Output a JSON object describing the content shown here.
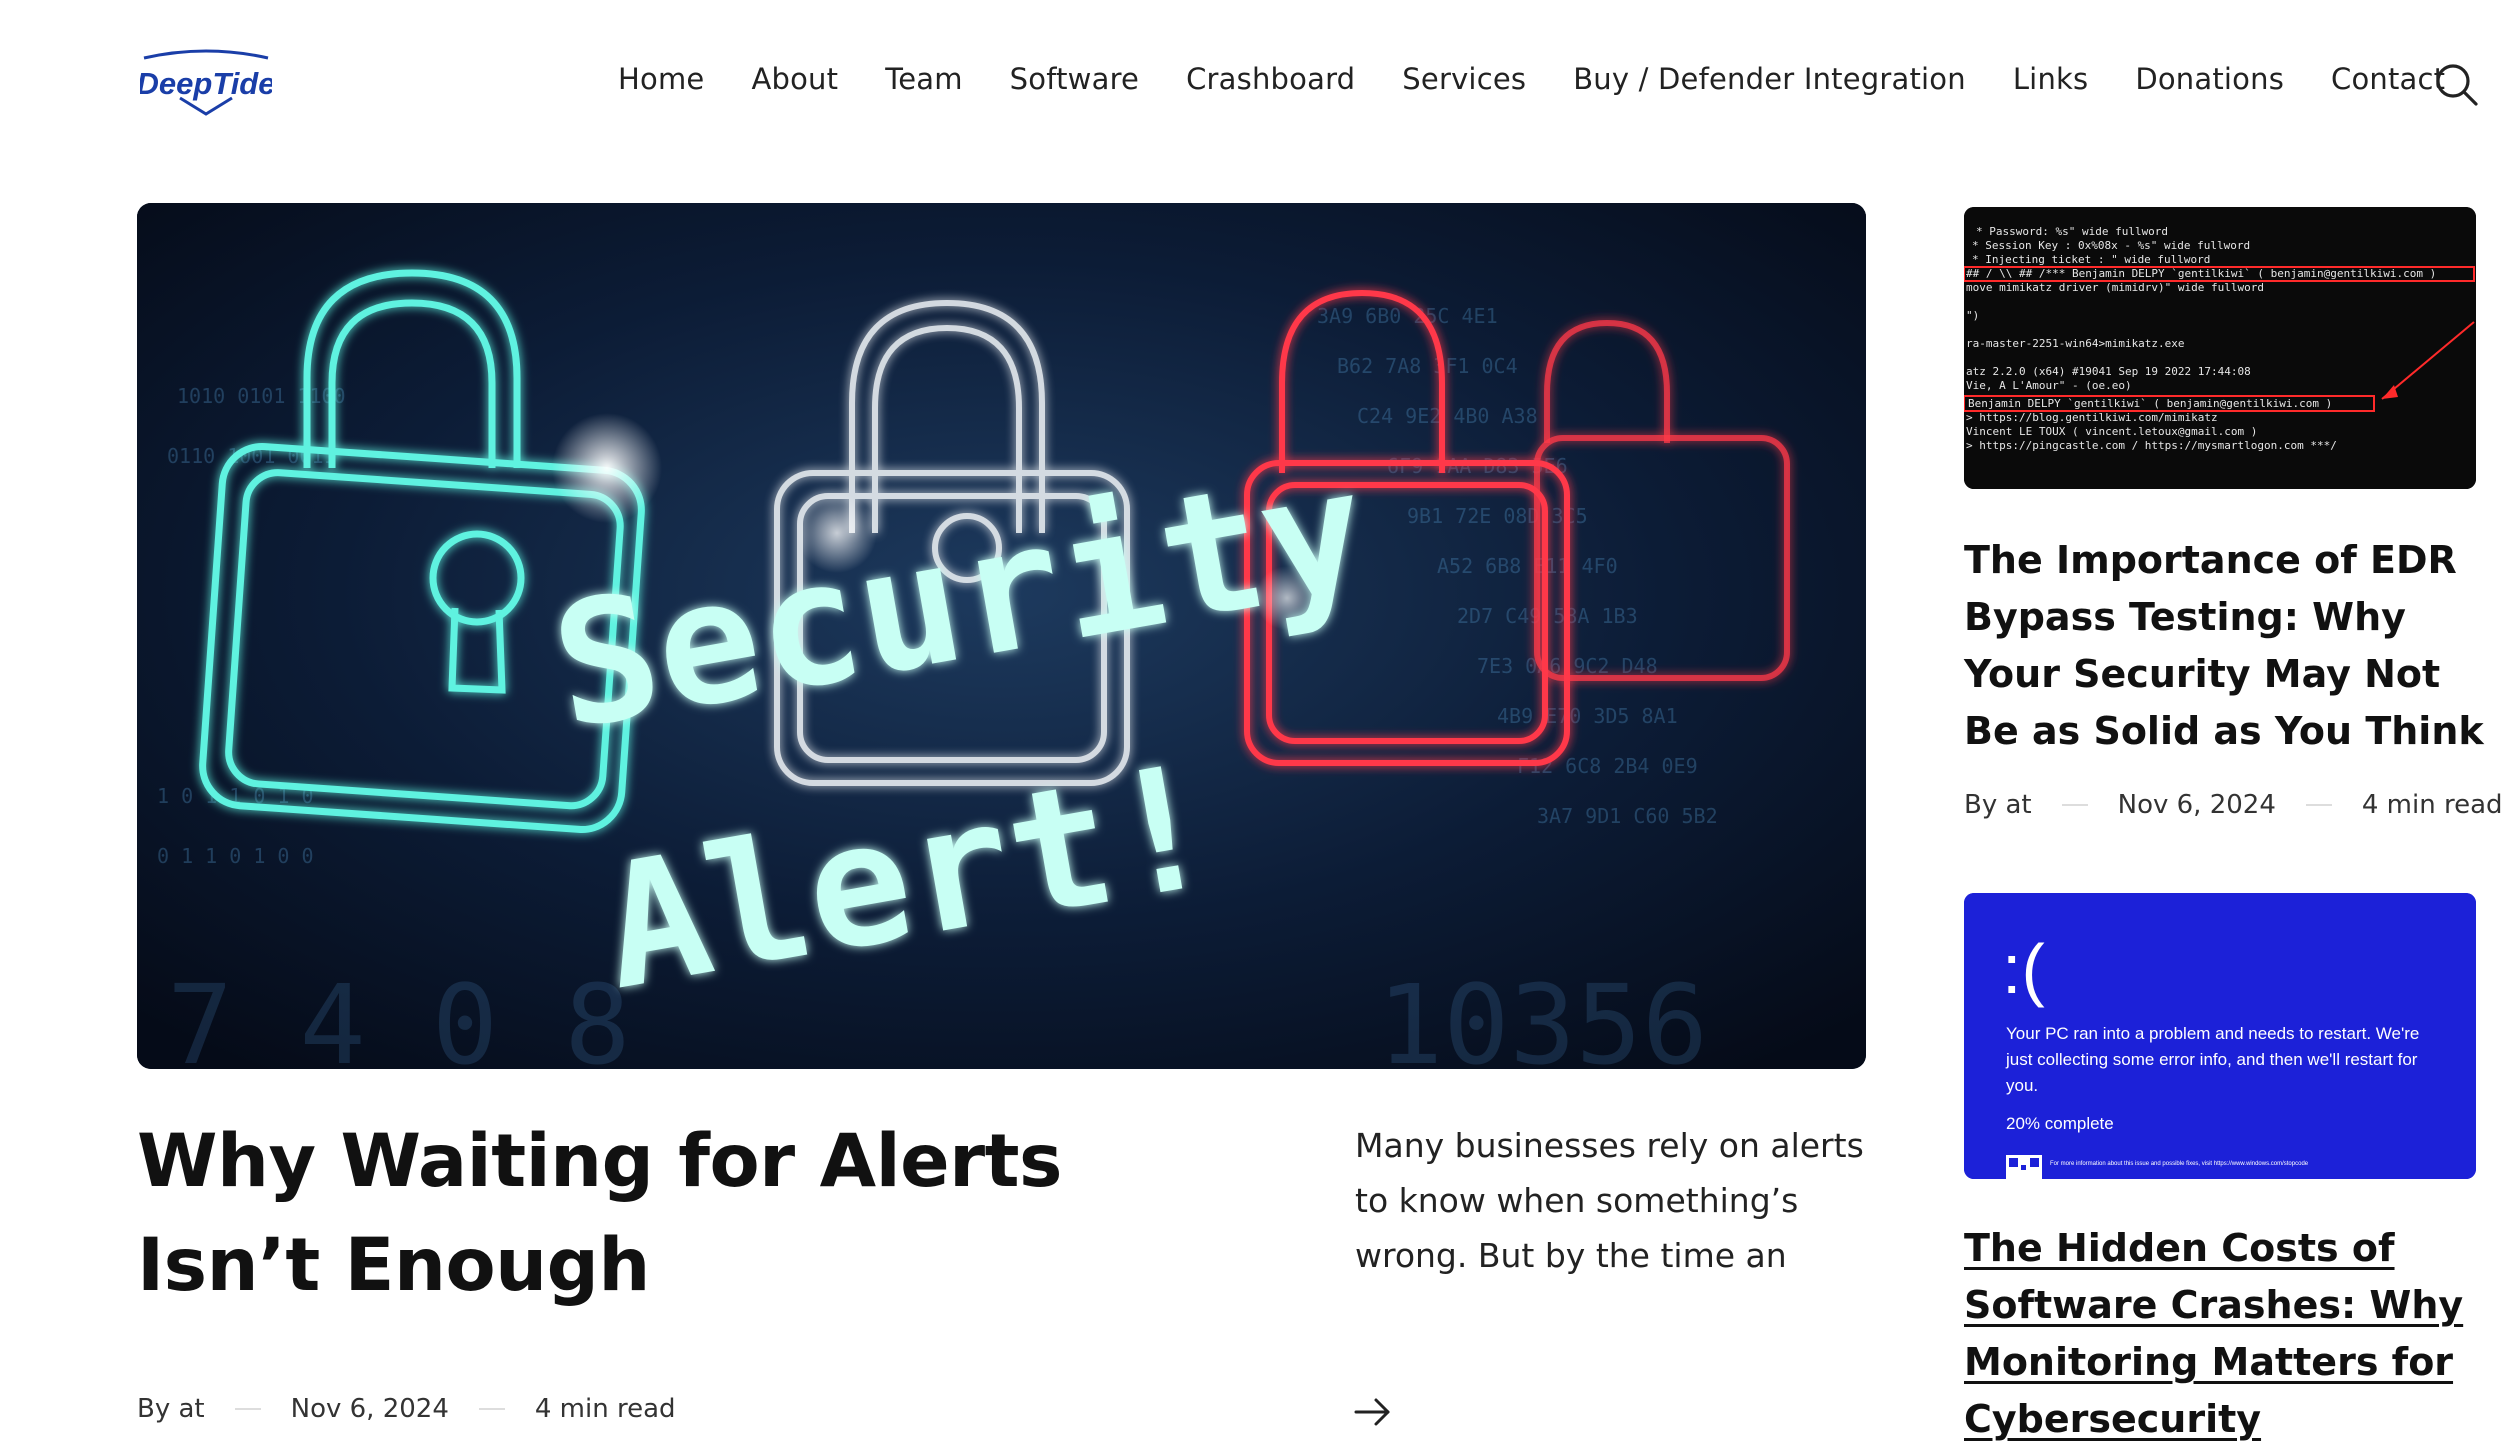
{
  "logo": {
    "text": "DeepTide"
  },
  "nav": {
    "items": [
      {
        "label": "Home"
      },
      {
        "label": "About"
      },
      {
        "label": "Team"
      },
      {
        "label": "Software"
      },
      {
        "label": "Crashboard"
      },
      {
        "label": "Services"
      },
      {
        "label": "Buy / Defender Integration"
      },
      {
        "label": "Links"
      },
      {
        "label": "Donations"
      },
      {
        "label": "Contact"
      }
    ],
    "search_icon": "search-icon"
  },
  "hero": {
    "image_text_line1": "Security",
    "image_text_line2": "Alert!",
    "title": "Why Waiting for Alerts Isn’t Enough",
    "excerpt": "Many businesses rely on alerts to know when something’s wrong. But by the time an alert goes off,…",
    "meta": {
      "by": "By at",
      "date": "Nov 6, 2024",
      "read": "4 min read"
    },
    "arrow_icon": "arrow-right-icon"
  },
  "side_posts": [
    {
      "title": "The Importance of EDR Bypass Testing: Why Your Security May Not Be as Solid as You Think",
      "meta": {
        "by": "By at",
        "date": "Nov 6, 2024",
        "read": "4 min read"
      },
      "terminal_lines": [
        "* Password: %s\" wide fullword",
        "* Session Key   : 0x%08x - %s\" wide fullword",
        "* Injecting ticket : \" wide fullword",
        "## / \\\\ ##  /*** Benjamin DELPY `gentilkiwi` ( benjamin@gentilkiwi.com )",
        "move mimikatz driver (mimidrv)\" wide fullword",
        "\")",
        "ra-master-2251-win64>mimikatz.exe",
        "atz 2.2.0 (x64) #19041 Sep 19 2022 17:44:08",
        "  Vie, A L'Amour\" - (oe.eo)",
        "Benjamin DELPY `gentilkiwi` ( benjamin@gentilkiwi.com )",
        "> https://blog.gentilkiwi.com/mimikatz",
        "  Vincent LE TOUX             ( vincent.letoux@gmail.com )",
        "> https://pingcastle.com / https://mysmartlogon.com ***/"
      ]
    },
    {
      "title": "The Hidden Costs of Software Crashes: Why Monitoring Matters for Cybersecurity",
      "bsod": {
        "face": ":(",
        "message_line1": "Your PC ran into a problem and needs to restart. We're",
        "message_line2": "just collecting some error info, and then we'll restart for",
        "message_line3": "you.",
        "progress": "20% complete",
        "footer": "For more information about this issue and possible fixes, visit https://www.windows.com/stopcode"
      }
    }
  ],
  "colors": {
    "accent_teal": "#5ff2e0",
    "accent_red": "#ff3848",
    "bsod_blue": "#1c21d8",
    "logo_blue": "#1a3ea8"
  }
}
